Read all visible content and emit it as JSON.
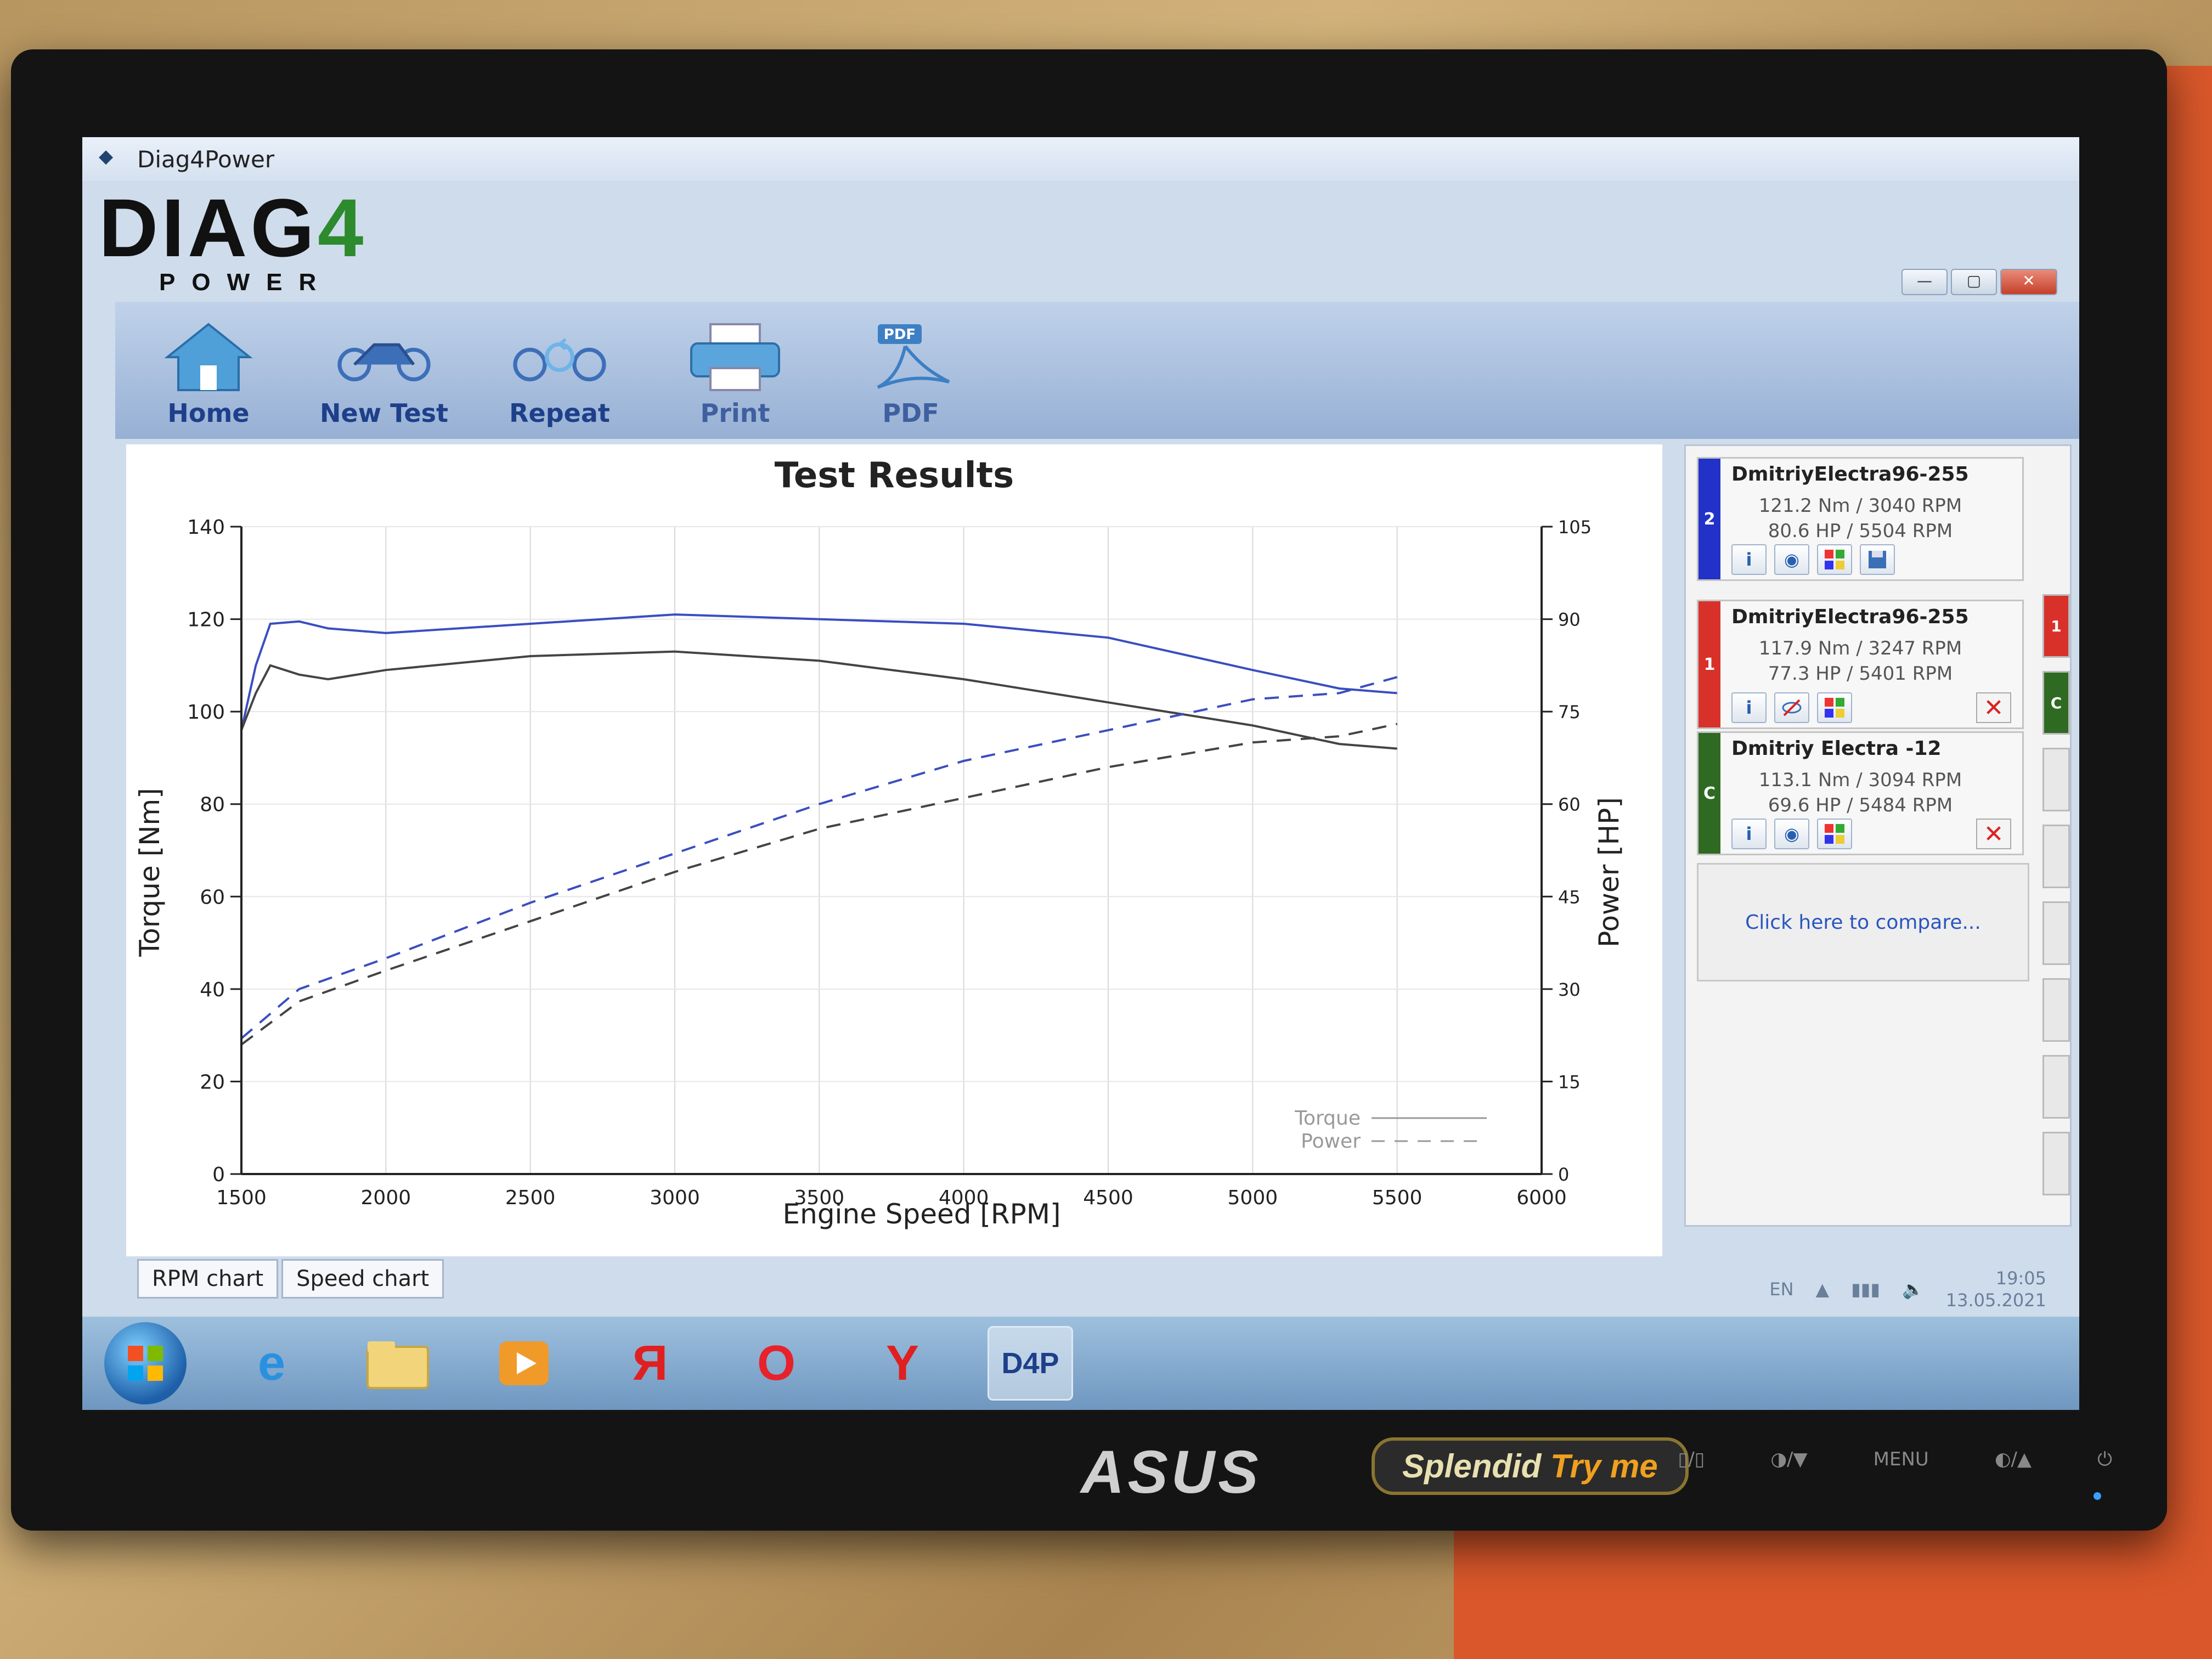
{
  "window": {
    "title": "Diag4Power"
  },
  "logo": {
    "main_a": "DIAG",
    "main_b": "4",
    "sub": "POWER"
  },
  "window_controls": {
    "minimize": "—",
    "maximize": "▢",
    "close": "✕"
  },
  "toolbar": {
    "home_label": "Home",
    "new_test_label": "New Test",
    "repeat_label": "Repeat",
    "print_label": "Print",
    "pdf_label": "PDF",
    "pdf_badge": "PDF"
  },
  "chart_data": {
    "type": "line",
    "title": "Test Results",
    "xlabel": "Engine Speed [RPM]",
    "ylabel": "Torque [Nm]",
    "y2label": "Power [HP]",
    "xlim": [
      1500,
      6000
    ],
    "ylim": [
      0,
      140
    ],
    "y2lim": [
      0,
      105
    ],
    "x_ticks": [
      1500,
      2000,
      2500,
      3000,
      3500,
      4000,
      4500,
      5000,
      5500,
      6000
    ],
    "y_ticks": [
      0,
      20,
      40,
      60,
      80,
      100,
      120,
      140
    ],
    "y2_ticks": [
      0,
      15,
      30,
      45,
      60,
      75,
      90,
      105
    ],
    "grid": true,
    "legend": {
      "position": "bottom-right",
      "torque_label": "Torque",
      "power_label": "Power"
    },
    "series": [
      {
        "name": "Torque",
        "run": "2",
        "color": "#3a4ec0",
        "style": "solid",
        "axis": "left",
        "x": [
          1500,
          1550,
          1600,
          1700,
          1800,
          2000,
          2500,
          3000,
          3500,
          4000,
          4500,
          5000,
          5300,
          5500
        ],
        "y": [
          96,
          110,
          119,
          119.5,
          118,
          117,
          119,
          121,
          120,
          119,
          116,
          109,
          105,
          104
        ]
      },
      {
        "name": "Torque",
        "run": "1",
        "color": "#444444",
        "style": "solid",
        "axis": "left",
        "x": [
          1500,
          1550,
          1600,
          1700,
          1800,
          2000,
          2500,
          3000,
          3500,
          4000,
          4500,
          5000,
          5300,
          5500
        ],
        "y": [
          96,
          104,
          110,
          108,
          107,
          109,
          112,
          113,
          111,
          107,
          102,
          97,
          93,
          92
        ]
      },
      {
        "name": "Power",
        "run": "2",
        "color": "#3a4ec0",
        "style": "dashed",
        "axis": "right",
        "x": [
          1500,
          1700,
          2000,
          2500,
          3000,
          3500,
          4000,
          4500,
          5000,
          5300,
          5500
        ],
        "y": [
          22,
          30,
          35,
          44,
          52,
          60,
          67,
          72,
          77,
          78,
          80.6
        ]
      },
      {
        "name": "Power",
        "run": "1",
        "color": "#444444",
        "style": "dashed",
        "axis": "right",
        "x": [
          1500,
          1700,
          2000,
          2500,
          3000,
          3500,
          4000,
          4500,
          5000,
          5300,
          5500
        ],
        "y": [
          21,
          28,
          33,
          41,
          49,
          56,
          61,
          66,
          70,
          71,
          73
        ]
      }
    ]
  },
  "runs": [
    {
      "id": "2",
      "name": "DmitriyElectra96-255",
      "torque": "121.2 Nm / 3040 RPM",
      "power": "80.6 HP / 5504 RPM",
      "color": "#2232c8"
    },
    {
      "id": "1",
      "name": "DmitriyElectra96-255",
      "torque": "117.9 Nm / 3247 RPM",
      "power": "77.3 HP / 5401 RPM",
      "color": "#d8312a"
    },
    {
      "id": "C",
      "name": "Dmitriy Electra -12",
      "torque": "113.1 Nm / 3094 RPM",
      "power": "69.6 HP / 5484 RPM",
      "color": "#2e6a22"
    }
  ],
  "run_buttons": {
    "info": "i",
    "view": "◉",
    "delete": "✕"
  },
  "compare": {
    "label": "Click here to compare..."
  },
  "slots": [
    {
      "label": "1"
    },
    {
      "label": "C"
    }
  ],
  "tabs": {
    "rpm_chart": "RPM chart",
    "speed_chart": "Speed chart"
  },
  "tray": {
    "lang": "EN",
    "time": "19:05",
    "date": "13.05.2021"
  },
  "taskbar": {
    "yandex": "Я",
    "opera": "O",
    "yandex_browser": "Y",
    "d4p": "D4P"
  },
  "monitor": {
    "brand": "ASUS",
    "splendid": "Splendid",
    "tryme": "Try me",
    "menu_label": "MENU"
  }
}
